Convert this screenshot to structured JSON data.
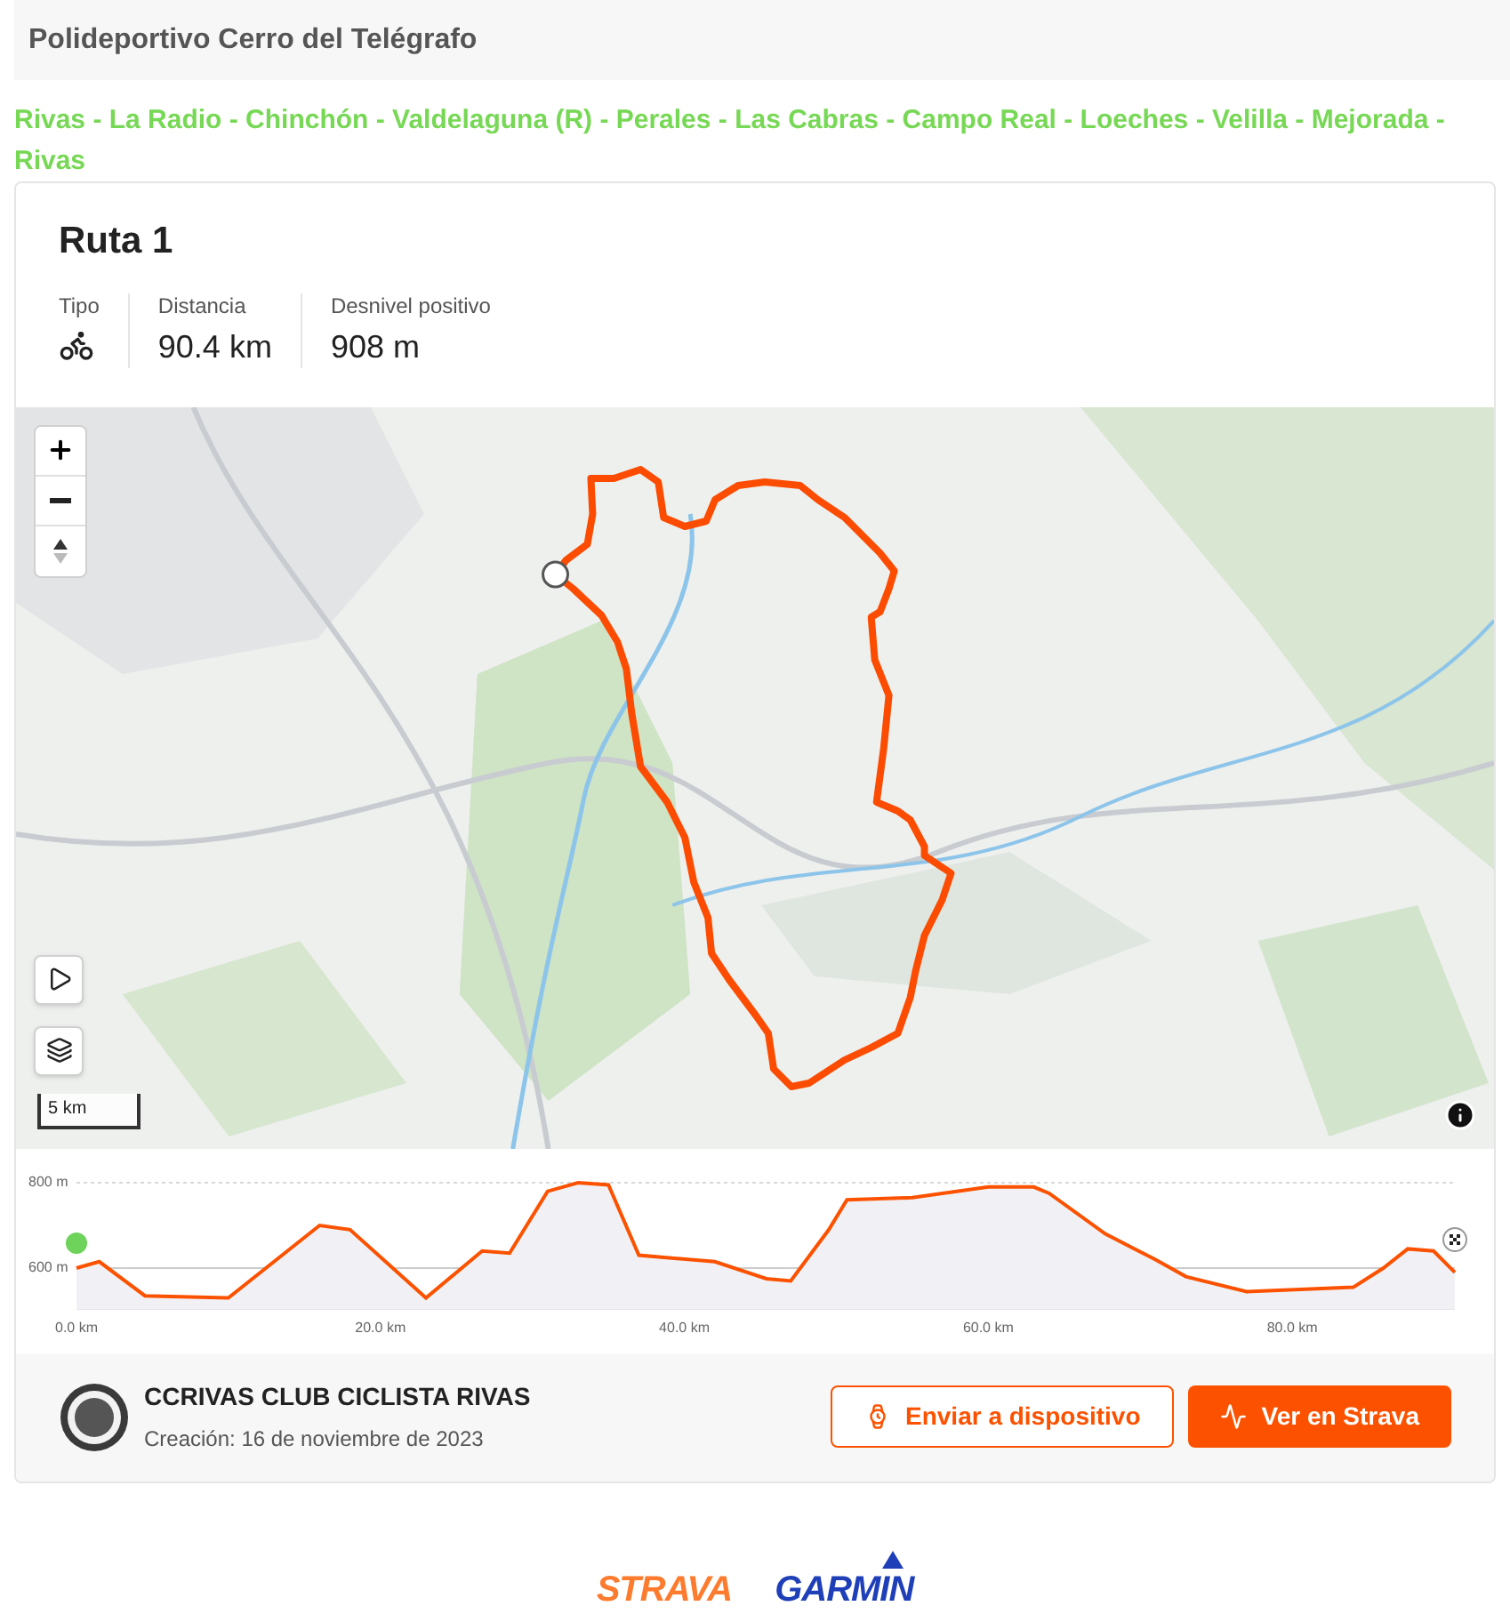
{
  "header": {
    "title": "Polideportivo Cerro del Telégrafo"
  },
  "route_description": "Rivas - La Radio - Chinchón - Valdelaguna (R) - Perales - Las Cabras - Campo Real - Loeches - Velilla - Mejorada - Rivas",
  "route": {
    "title": "Ruta 1",
    "stats": [
      {
        "label": "Tipo",
        "kind": "icon"
      },
      {
        "label": "Distancia",
        "kind": "text",
        "value": "90.4 km"
      },
      {
        "label": "Desnivel positivo",
        "kind": "text",
        "value": "908 m"
      }
    ]
  },
  "map": {
    "scale": "5 km"
  },
  "elevation": {
    "chart_data": {
      "type": "area",
      "x": [
        0,
        1.5,
        4.5,
        10,
        16,
        18,
        23,
        26.7,
        28.5,
        31,
        33,
        35,
        37,
        42,
        45.4,
        47,
        49.5,
        50.7,
        55,
        60,
        63,
        64,
        67.7,
        71,
        73,
        77,
        84,
        86,
        87.6,
        89.3,
        90.7
      ],
      "series": [
        {
          "color": "#fc5200",
          "values": [
            600,
            615,
            535,
            530,
            700,
            690,
            530,
            640,
            635,
            780,
            800,
            795,
            630,
            615,
            575,
            570,
            690,
            760,
            765,
            790,
            790,
            775,
            680,
            620,
            580,
            545,
            555,
            600,
            645,
            640,
            590
          ]
        }
      ],
      "xlim": [
        0,
        90.7
      ],
      "ylim": [
        504,
        800
      ],
      "xticks": [
        {
          "value": 0,
          "label": "0.0 km"
        },
        {
          "value": 20,
          "label": "20.0 km"
        },
        {
          "value": 40,
          "label": "40.0 km"
        },
        {
          "value": 60,
          "label": "60.0 km"
        },
        {
          "value": 80,
          "label": "80.0 km"
        }
      ],
      "yticks": [
        {
          "value": 600,
          "label": "600 m"
        },
        {
          "value": 800,
          "label": "800 m"
        }
      ]
    }
  },
  "owner": {
    "name": "CCRIVAS CLUB CICLISTA RIVAS",
    "created": "Creación: 16 de noviembre de 2023"
  },
  "buttons": [
    {
      "label": "Enviar a dispositivo",
      "kind": "outline"
    },
    {
      "label": "Ver en Strava",
      "kind": "primary"
    }
  ],
  "footer_logos": [
    {
      "text": "STRAVA",
      "color": "#fc7b2f",
      "kind": "plain"
    },
    {
      "text": "GARMIN",
      "color": "#1f3fb8",
      "kind": "garmin"
    }
  ]
}
